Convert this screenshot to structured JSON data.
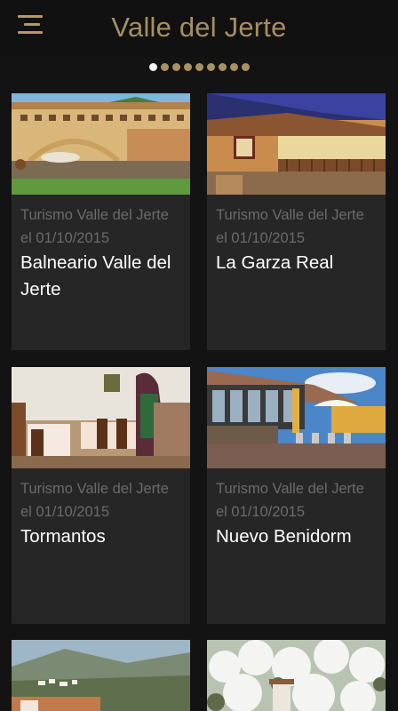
{
  "app": {
    "title": "Valle del Jerte"
  },
  "carousel": {
    "count": 9,
    "active": 0
  },
  "cards": [
    {
      "meta": "Turismo Valle del Jerte el 01/10/2015",
      "title": "Balneario Valle del Jerte",
      "image": "balneario-hotel-photo"
    },
    {
      "meta": "Turismo Valle del Jerte el 01/10/2015",
      "title": "La Garza Real",
      "image": "la-garza-real-photo"
    },
    {
      "meta": "Turismo Valle del Jerte el 01/10/2015",
      "title": "Tormantos",
      "image": "tormantos-dining-room-photo"
    },
    {
      "meta": "Turismo Valle del Jerte el 01/10/2015",
      "title": "Nuevo Benidorm",
      "image": "nuevo-benidorm-terrace-photo"
    },
    {
      "meta": "",
      "title": "",
      "image": "mountain-village-photo"
    },
    {
      "meta": "",
      "title": "",
      "image": "cherry-blossom-photo"
    }
  ]
}
